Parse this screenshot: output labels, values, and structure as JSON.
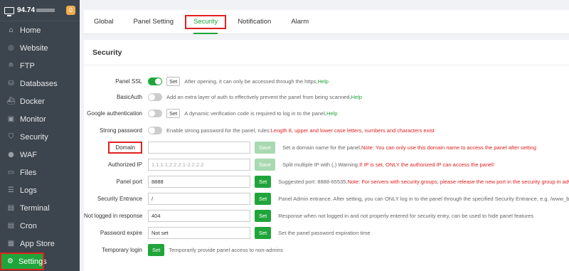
{
  "sidebar": {
    "server_ip": "94.74",
    "badge_count": "0",
    "items": [
      {
        "label": "Home",
        "icon": "⌂"
      },
      {
        "label": "Website",
        "icon": "◎"
      },
      {
        "label": "FTP",
        "icon": "≘"
      },
      {
        "label": "Databases",
        "icon": "⛁"
      },
      {
        "label": "Docker",
        "icon": "⛴"
      },
      {
        "label": "Monitor",
        "icon": "▣"
      },
      {
        "label": "Security",
        "icon": "⛉"
      },
      {
        "label": "WAF",
        "icon": "●"
      },
      {
        "label": "Files",
        "icon": "▭"
      },
      {
        "label": "Logs",
        "icon": "☰"
      },
      {
        "label": "Terminal",
        "icon": "▤"
      },
      {
        "label": "Cron",
        "icon": "▤"
      },
      {
        "label": "App Store",
        "icon": "▦"
      },
      {
        "label": "Settings",
        "icon": "⚙"
      }
    ]
  },
  "tabs": [
    "Global",
    "Panel Setting",
    "Security",
    "Notification",
    "Alarm"
  ],
  "panel": {
    "title": "Security",
    "panel_ssl": {
      "label": "Panel SSL",
      "set": "Set",
      "desc": "After opening, it can only be accessed through the https,",
      "help": "Help"
    },
    "basic_auth": {
      "label": "BasicAuth",
      "desc": "Add an extra layer of auth to effectively prevent the panel from being scanned,",
      "help": "Help"
    },
    "google_auth": {
      "label": "Google authentication",
      "set": "Set",
      "desc": "A dynamic verification code is required to log in to the panel,",
      "help": "Help"
    },
    "strong_password": {
      "label": "Strong password",
      "desc": "Enable strong password for the panel, rules: ",
      "warn": "Length 8, upper and lower case letters, numbers and characters exist"
    },
    "domain": {
      "label": "Domain",
      "value": "",
      "button": "Save",
      "desc": "Set a domain name for the panel,",
      "warn": "Note: You can only use this domain name to access the panel after setting"
    },
    "authorized_ip": {
      "label": "Authorized IP",
      "placeholder": "1.1.1.1,2.2.2.1-2.2.2.2",
      "button": "Save",
      "desc": "Split multiple IP with (,) Warning: ",
      "warn": "If IP is set, ONLY the authorized IP can access the panel!"
    },
    "panel_port": {
      "label": "Panel port",
      "value": "8888",
      "button": "Set",
      "desc": "Suggested port: 8888-65535, ",
      "warn": "Note: For servers with security groups, please release the new port in the security group in advance"
    },
    "security_entrance": {
      "label": "Security Entrance",
      "value": "/",
      "button": "Set",
      "desc": "Panel Admin entrance. After setting, you can ONLY log in to the panel through the specified Security Entrance, e.g. /www_bt_cn"
    },
    "not_logged_response": {
      "label": "Not logged in response",
      "value": "404",
      "button": "Set",
      "desc": "Response when not logged in and not properly entered for security entry, can be used to hide panel features"
    },
    "password_expire": {
      "label": "Password expire",
      "value": "Not set",
      "button": "Set",
      "desc": "Set the panel password expiration time"
    },
    "temporary_login": {
      "label": "Temporary login",
      "button": "Set",
      "desc": "Temporarily provide panel access to non-admins"
    }
  }
}
